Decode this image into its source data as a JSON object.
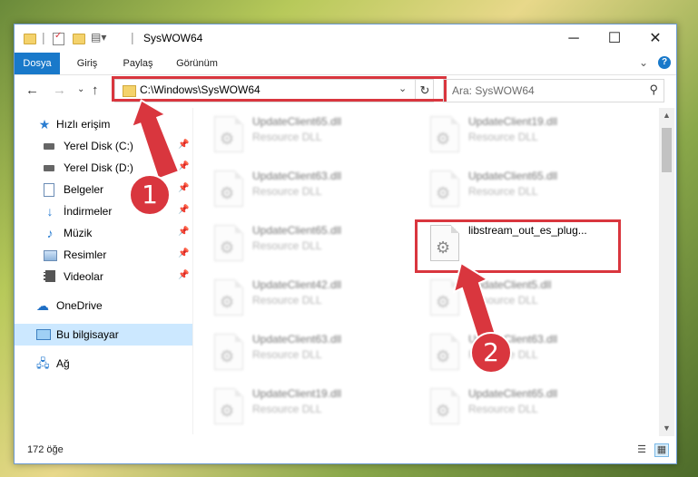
{
  "window": {
    "title": "SysWOW64",
    "controls": {
      "minimize": "─",
      "maximize": "☐",
      "close": "✕"
    }
  },
  "ribbon": {
    "tabs": [
      "Dosya",
      "Giriş",
      "Paylaş",
      "Görünüm"
    ],
    "expand_icon": "chevron-down-icon",
    "help_icon": "?"
  },
  "address": {
    "path": "C:\\Windows\\SysWOW64",
    "search_placeholder": "Ara: SysWOW64"
  },
  "navigation": [
    {
      "label": "Hızlı erişim",
      "icon": "star-icon",
      "pinned": false
    },
    {
      "label": "Yerel Disk (C:)",
      "icon": "drive-icon",
      "pinned": true
    },
    {
      "label": "Yerel Disk (D:)",
      "icon": "drive-icon",
      "pinned": true
    },
    {
      "label": "Belgeler",
      "icon": "documents-icon",
      "pinned": true
    },
    {
      "label": "İndirmeler",
      "icon": "download-icon",
      "pinned": true
    },
    {
      "label": "Müzik",
      "icon": "music-icon",
      "pinned": true
    },
    {
      "label": "Resimler",
      "icon": "pictures-icon",
      "pinned": true
    },
    {
      "label": "Videolar",
      "icon": "videos-icon",
      "pinned": true
    },
    {
      "label": "OneDrive",
      "icon": "cloud-icon",
      "pinned": false
    },
    {
      "label": "Bu bilgisayar",
      "icon": "computer-icon",
      "pinned": false,
      "selected": true
    },
    {
      "label": "Ağ",
      "icon": "network-icon",
      "pinned": false
    }
  ],
  "files": [
    {
      "name": "UpdateClient65.dll",
      "type": "Resource DLL",
      "blurred": true
    },
    {
      "name": "UpdateClient19.dll",
      "type": "Resource DLL",
      "blurred": true
    },
    {
      "name": "UpdateClient63.dll",
      "type": "Resource DLL",
      "blurred": true
    },
    {
      "name": "UpdateClient65.dll",
      "type": "Resource DLL",
      "blurred": true
    },
    {
      "name": "UpdateClient65.dll",
      "type": "Resource DLL",
      "blurred": true
    },
    {
      "name": "libstream_out_es_plug...",
      "type": "",
      "blurred": false
    },
    {
      "name": "UpdateClient42.dll",
      "type": "Resource DLL",
      "blurred": true
    },
    {
      "name": "UpdateClient5.dll",
      "type": "Resource DLL",
      "blurred": true
    },
    {
      "name": "UpdateClient63.dll",
      "type": "Resource DLL",
      "blurred": true
    },
    {
      "name": "UpdateClient63.dll",
      "type": "Resource DLL",
      "blurred": true
    },
    {
      "name": "UpdateClient19.dll",
      "type": "Resource DLL",
      "blurred": true
    },
    {
      "name": "UpdateClient65.dll",
      "type": "Resource DLL",
      "blurred": true
    }
  ],
  "status": {
    "item_count": "172 öğe"
  },
  "annotations": {
    "marker1": "1",
    "marker2": "2",
    "color": "#d9363e"
  }
}
